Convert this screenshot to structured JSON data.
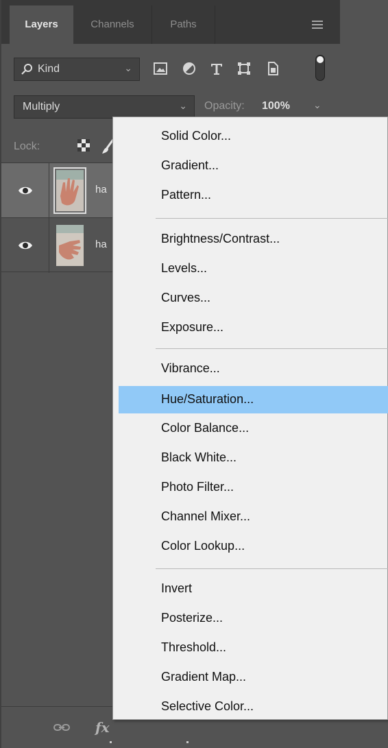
{
  "tabs": [
    {
      "label": "Layers",
      "active": true
    },
    {
      "label": "Channels",
      "active": false
    },
    {
      "label": "Paths",
      "active": false
    }
  ],
  "filter": {
    "kind_label": "Kind",
    "icons": [
      "image-filter-icon",
      "adjustment-filter-icon",
      "type-filter-icon",
      "shape-filter-icon",
      "smart-object-filter-icon",
      "filter-toggle"
    ]
  },
  "blend": {
    "mode": "Multiply",
    "opacity_label": "Opacity:",
    "opacity_value": "100%"
  },
  "lock": {
    "label": "Lock:"
  },
  "layers": [
    {
      "name": "ha",
      "selected": true,
      "visible": true
    },
    {
      "name": "ha",
      "selected": false,
      "visible": true
    }
  ],
  "bottom": {
    "fx_label": "fx"
  },
  "menu": {
    "groups": [
      [
        "Solid Color...",
        "Gradient...",
        "Pattern..."
      ],
      [
        "Brightness/Contrast...",
        "Levels...",
        "Curves...",
        "Exposure..."
      ],
      [
        "Vibrance...",
        "Hue/Saturation...",
        "Color Balance...",
        "Black  White...",
        "Photo Filter...",
        "Channel Mixer...",
        "Color Lookup..."
      ],
      [
        "Invert",
        "Posterize...",
        "Threshold...",
        "Gradient Map...",
        "Selective Color..."
      ]
    ],
    "highlighted": "Hue/Saturation..."
  },
  "colors": {
    "panel": "#535353",
    "tabbar": "#383838",
    "selected_row": "#6b6b6b",
    "menu_bg": "#f0f0f0",
    "menu_highlight": "#91c9f7"
  }
}
